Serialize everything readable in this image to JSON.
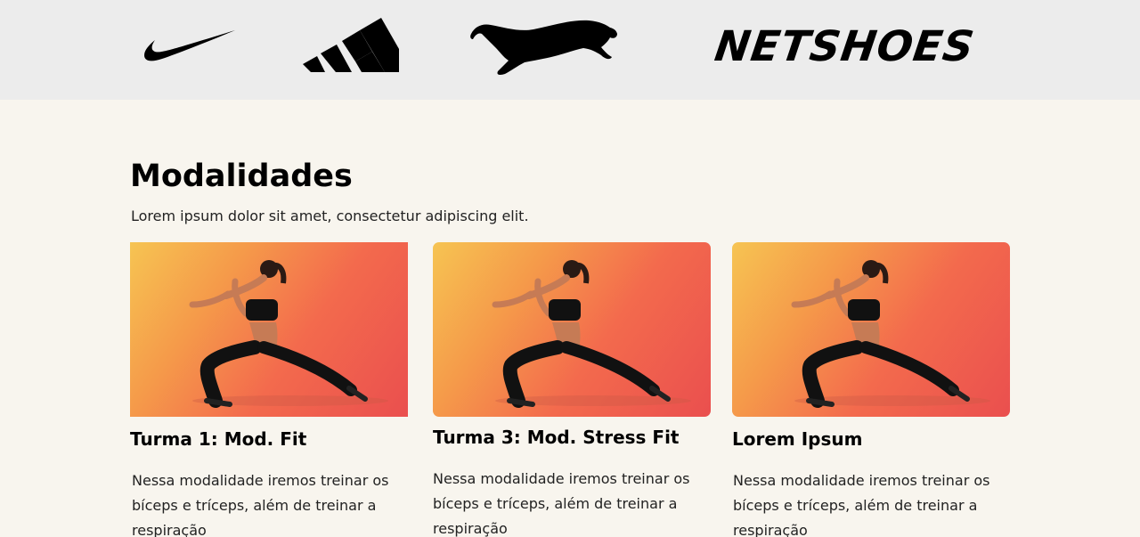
{
  "brands": [
    {
      "name": "Nike",
      "icon": "nike-swoosh-logo"
    },
    {
      "name": "Adidas",
      "icon": "adidas-stripes-logo"
    },
    {
      "name": "Puma",
      "icon": "puma-cat-logo"
    },
    {
      "name": "Netshoes",
      "text": "NETSHOES"
    }
  ],
  "section": {
    "title": "Modalidades",
    "subtitle": "Lorem ipsum dolor sit amet, consectetur adipiscing elit."
  },
  "cards": [
    {
      "title": "Turma 1: Mod. Fit",
      "text": "Nessa modalidade iremos treinar os bíceps e tríceps, além de treinar a respiração",
      "image": "woman-stretching-lunge-photo"
    },
    {
      "title": "Turma 3: Mod. Stress Fit",
      "text": "Nessa modalidade iremos treinar os bíceps e tríceps, além de treinar a respiração",
      "image": "woman-stretching-lunge-photo"
    },
    {
      "title": "Lorem Ipsum",
      "text": "Nessa modalidade iremos treinar os bíceps e tríceps, além de treinar a respiração",
      "image": "woman-stretching-lunge-photo"
    }
  ],
  "colors": {
    "brand_bar": "#ececec",
    "page_background": "#f8f5ee",
    "photo_gradient_start": "#f6c452",
    "photo_gradient_end": "#ea4f4e"
  }
}
